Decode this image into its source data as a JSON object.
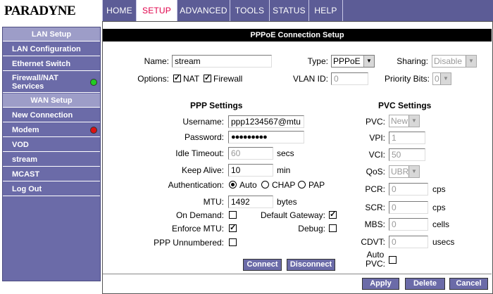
{
  "brand": {
    "logo_text": "PARADYNE"
  },
  "nav": {
    "tabs": [
      {
        "label": "HOME"
      },
      {
        "label": "SETUP",
        "active": true
      },
      {
        "label": "ADVANCED"
      },
      {
        "label": "TOOLS"
      },
      {
        "label": "STATUS"
      },
      {
        "label": "HELP"
      }
    ]
  },
  "sidebar": {
    "lan_header": "LAN Setup",
    "lan_config": "LAN Configuration",
    "ethernet_switch": "Ethernet Switch",
    "firewall_line1": "Firewall/NAT",
    "firewall_line2": "Services",
    "wan_header": "WAN Setup",
    "new_connection": "New Connection",
    "modem": "Modem",
    "vod": "VOD",
    "stream": "stream",
    "mcast": "MCAST",
    "logout": "Log Out",
    "status_colors": {
      "firewall": "#22cc22",
      "modem": "#dd1111"
    }
  },
  "page": {
    "title": "PPPoE Connection Setup"
  },
  "general": {
    "name_label": "Name:",
    "name_value": "stream",
    "type_label": "Type:",
    "type_value": "PPPoE",
    "sharing_label": "Sharing:",
    "sharing_value": "Disable",
    "options_label": "Options:",
    "nat_label": "NAT",
    "firewall_label": "Firewall",
    "vlan_label": "VLAN ID:",
    "vlan_value": "0",
    "priority_label": "Priority Bits:",
    "priority_value": "0"
  },
  "ppp": {
    "heading": "PPP Settings",
    "username_label": "Username:",
    "username_value": "ppp1234567@mtu",
    "password_label": "Password:",
    "password_value": "●●●●●●●●●",
    "idle_label": "Idle Timeout:",
    "idle_value": "60",
    "idle_unit": "secs",
    "keepalive_label": "Keep Alive:",
    "keepalive_value": "10",
    "keepalive_unit": "min",
    "auth_label": "Authentication:",
    "auth_auto": "Auto",
    "auth_chap": "CHAP",
    "auth_pap": "PAP",
    "mtu_label": "MTU:",
    "mtu_value": "1492",
    "mtu_unit": "bytes",
    "ondemand_label": "On Demand:",
    "default_gw_label": "Default Gateway:",
    "enforce_mtu_label": "Enforce MTU:",
    "debug_label": "Debug:",
    "unnumbered_label": "PPP Unnumbered:",
    "connect_label": "Connect",
    "disconnect_label": "Disconnect"
  },
  "pvc": {
    "heading": "PVC Settings",
    "pvc_label": "PVC:",
    "pvc_value": "New",
    "vpi_label": "VPI:",
    "vpi_value": "1",
    "vci_label": "VCI:",
    "vci_value": "50",
    "qos_label": "QoS:",
    "qos_value": "UBR",
    "pcr_label": "PCR:",
    "pcr_value": "0",
    "pcr_unit": "cps",
    "scr_label": "SCR:",
    "scr_value": "0",
    "scr_unit": "cps",
    "mbs_label": "MBS:",
    "mbs_value": "0",
    "mbs_unit": "cells",
    "cdvt_label": "CDVT:",
    "cdvt_value": "0",
    "cdvt_unit": "usecs",
    "autopvc_line1": "Auto",
    "autopvc_line2": "PVC:"
  },
  "footer": {
    "apply_label": "Apply",
    "delete_label": "Delete",
    "cancel_label": "Cancel"
  }
}
